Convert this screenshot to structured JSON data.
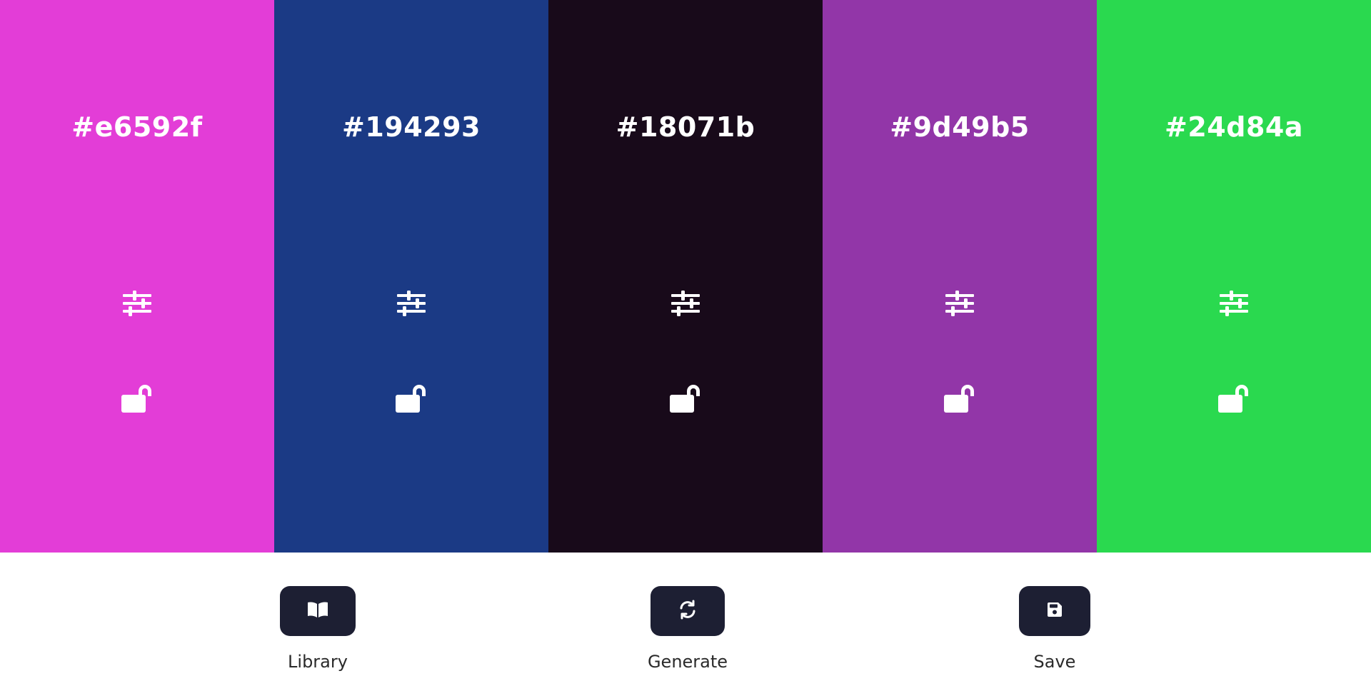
{
  "palette": {
    "swatches": [
      {
        "hex": "#e6592f",
        "color": "#e33dd7"
      },
      {
        "hex": "#194293",
        "color": "#1b3a85"
      },
      {
        "hex": "#18071b",
        "color": "#180a1a"
      },
      {
        "hex": "#9d49b5",
        "color": "#9236a8"
      },
      {
        "hex": "#24d84a",
        "color": "#2ad94f"
      }
    ],
    "icons": {
      "adjust": "sliders-icon",
      "lock": "unlocked-padlock-icon"
    }
  },
  "toolbar": {
    "library": {
      "label": "Library",
      "icon": "book-icon"
    },
    "generate": {
      "label": "Generate",
      "icon": "refresh-icon"
    },
    "save": {
      "label": "Save",
      "icon": "floppy-disk-icon"
    },
    "button_color": "#1d1f33"
  }
}
